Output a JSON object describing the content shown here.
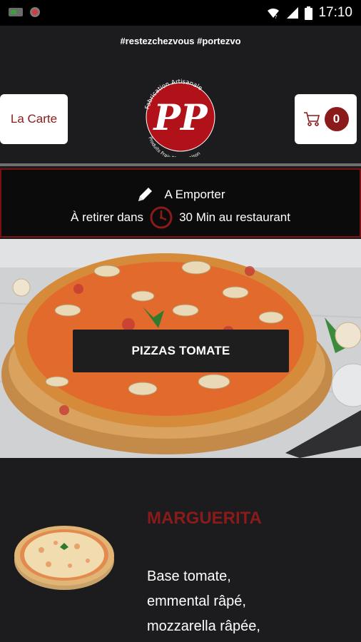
{
  "status_bar": {
    "time": "17:10"
  },
  "header": {
    "hashtags": "#restezchezvous #portezvo",
    "menu_button": "La Carte",
    "cart_count": "0",
    "logo": {
      "initials": "PP",
      "arc_top": "Fabrication Artisanale",
      "arc_bottom": "Produits Frais Pâtes maison"
    }
  },
  "order_info": {
    "mode": "A Emporter",
    "pickup_prefix": "À retirer dans",
    "pickup_suffix": "30 Min au restaurant"
  },
  "hero": {
    "category_button": "PIZZAS TOMATE"
  },
  "product": {
    "name": "MARGUERITA",
    "description": "Base tomate,\nemmental râpé,\nmozzarella râpée,"
  },
  "colors": {
    "accent": "#8b1a1a",
    "background": "#1c1c1e"
  }
}
